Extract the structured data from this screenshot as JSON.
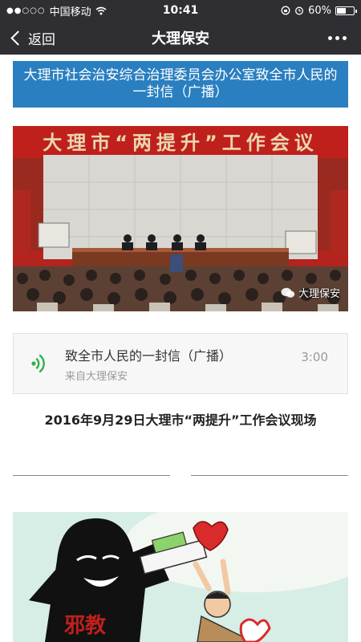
{
  "status_bar": {
    "signal": "●●○○○",
    "carrier": "中国移动",
    "time": "10:41",
    "battery": "60%",
    "battery_level": 0.6
  },
  "nav": {
    "back_label": "返回",
    "title": "大理保安"
  },
  "article": {
    "heading": "大理市社会治安综合治理委员会办公室致全市人民的一封信（广播）",
    "photo": {
      "banner_text": "大理市“两提升”工作会议",
      "watermark": "大理保安"
    },
    "audio": {
      "title": "致全市人民的一封信（广播）",
      "source": "来自大理保安",
      "duration": "3:00"
    },
    "caption": "2016年9月29日大理市“两提升”工作会议现场",
    "cartoon_text": "邪教"
  },
  "colors": {
    "bar_bg": "#2e2e33",
    "heading_bg": "#2a7fc0",
    "audio_accent": "#2bb24c"
  }
}
